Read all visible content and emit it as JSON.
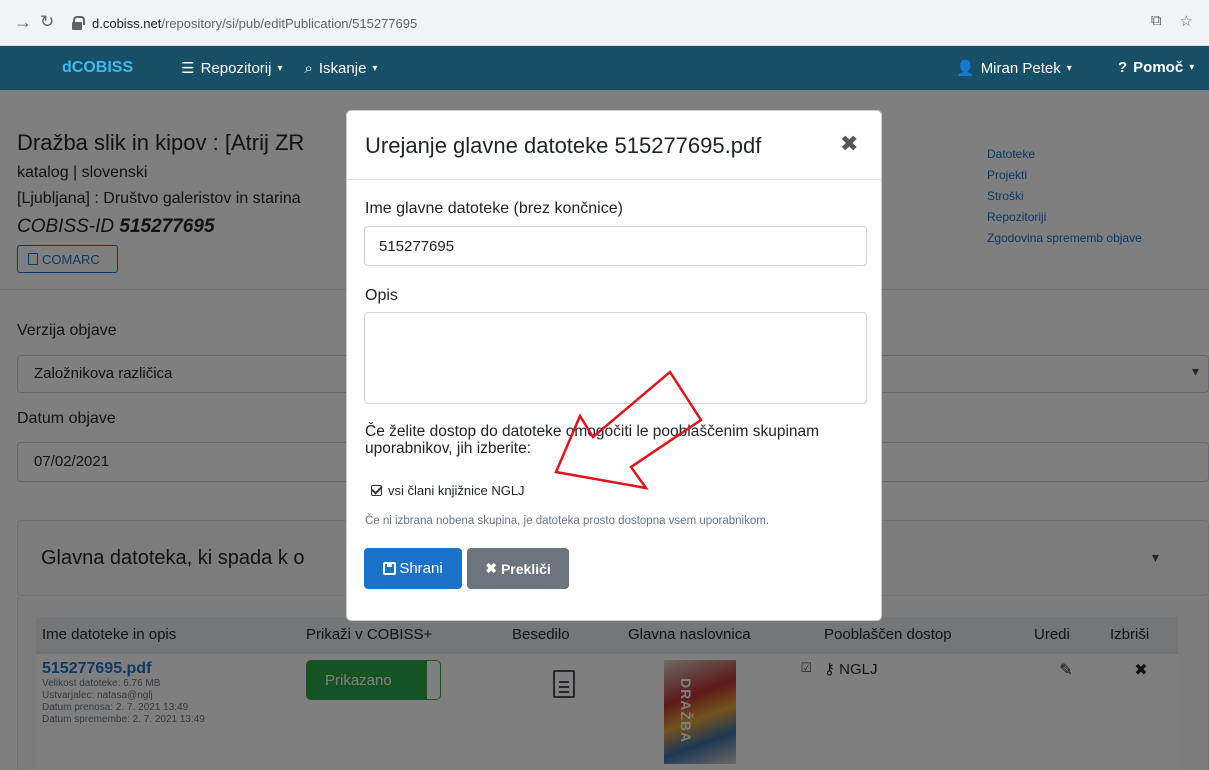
{
  "browser": {
    "back_icon": "arrow-right-icon",
    "reload_icon": "reload-icon",
    "url_host": "d.cobiss.net",
    "url_path": "/repository/si/pub/editPublication/515277695",
    "translate_icon": "translate-icon",
    "star_icon": "star-icon"
  },
  "navbar": {
    "brand": "dCOBISS",
    "repo_label": "Repozitorij",
    "search_label": "Iskanje",
    "user_label": "Miran Petek",
    "help_label": "Pomoč"
  },
  "publication": {
    "title": "Dražba slik in kipov : [Atrij ZR",
    "type_lang": "katalog | slovenski",
    "publisher": "[Ljubljana] : Društvo galeristov in starina",
    "cobiss_prefix": "COBISS-ID",
    "cobiss_id": "515277695",
    "comarc_label": "COMARC"
  },
  "side_links": [
    "Datoteke",
    "Projekti",
    "Stroški",
    "Repozitoriji",
    "Zgodovina sprememb objave"
  ],
  "form": {
    "version_label": "Verzija objave",
    "version_value": "Založnikova različica",
    "date_label": "Datum objave",
    "date_value": "07/02/2021"
  },
  "accordion": {
    "title": "Glavna datoteka, ki spada k o"
  },
  "table": {
    "headers": [
      "Ime datoteke in opis",
      "Prikaži v COBISS+",
      "Besedilo",
      "Glavna naslovnica",
      "Pooblaščen dostop",
      "Uredi",
      "Izbriši"
    ],
    "row": {
      "file_name": "515277695.pdf",
      "info": [
        "Velikost datoteke: 6.76 MB",
        "Ustvarjalec: natasa@nglj",
        "Datum prenosa: 2. 7. 2021 13:49",
        "Datum spremembe: 2. 7. 2021 13:49"
      ],
      "shown_label": "Prikazano",
      "cover_text": "DRAŽBA",
      "access": "NGLJ"
    }
  },
  "modal": {
    "title": "Urejanje glavne datoteke 515277695.pdf",
    "name_label": "Ime glavne datoteke (brez končnice)",
    "name_value": "515277695",
    "desc_label": "Opis",
    "notice": "Če želite dostop do datoteke omogočiti le pooblaščenim skupinam uporabnikov, jih izberite:",
    "group_label": "vsi člani knjižnice NGLJ",
    "hint": "Če ni izbrana nobena skupina, je datoteka prosto dostopna vsem uporabnikom.",
    "save_label": "Shrani",
    "cancel_label": "Prekliči"
  },
  "colors": {
    "navbar": "#164f66",
    "brand": "#3fb8f0",
    "primary": "#1a73c8",
    "success": "#28a745",
    "secondary": "#6c757d",
    "annotation": "#e0141e"
  }
}
